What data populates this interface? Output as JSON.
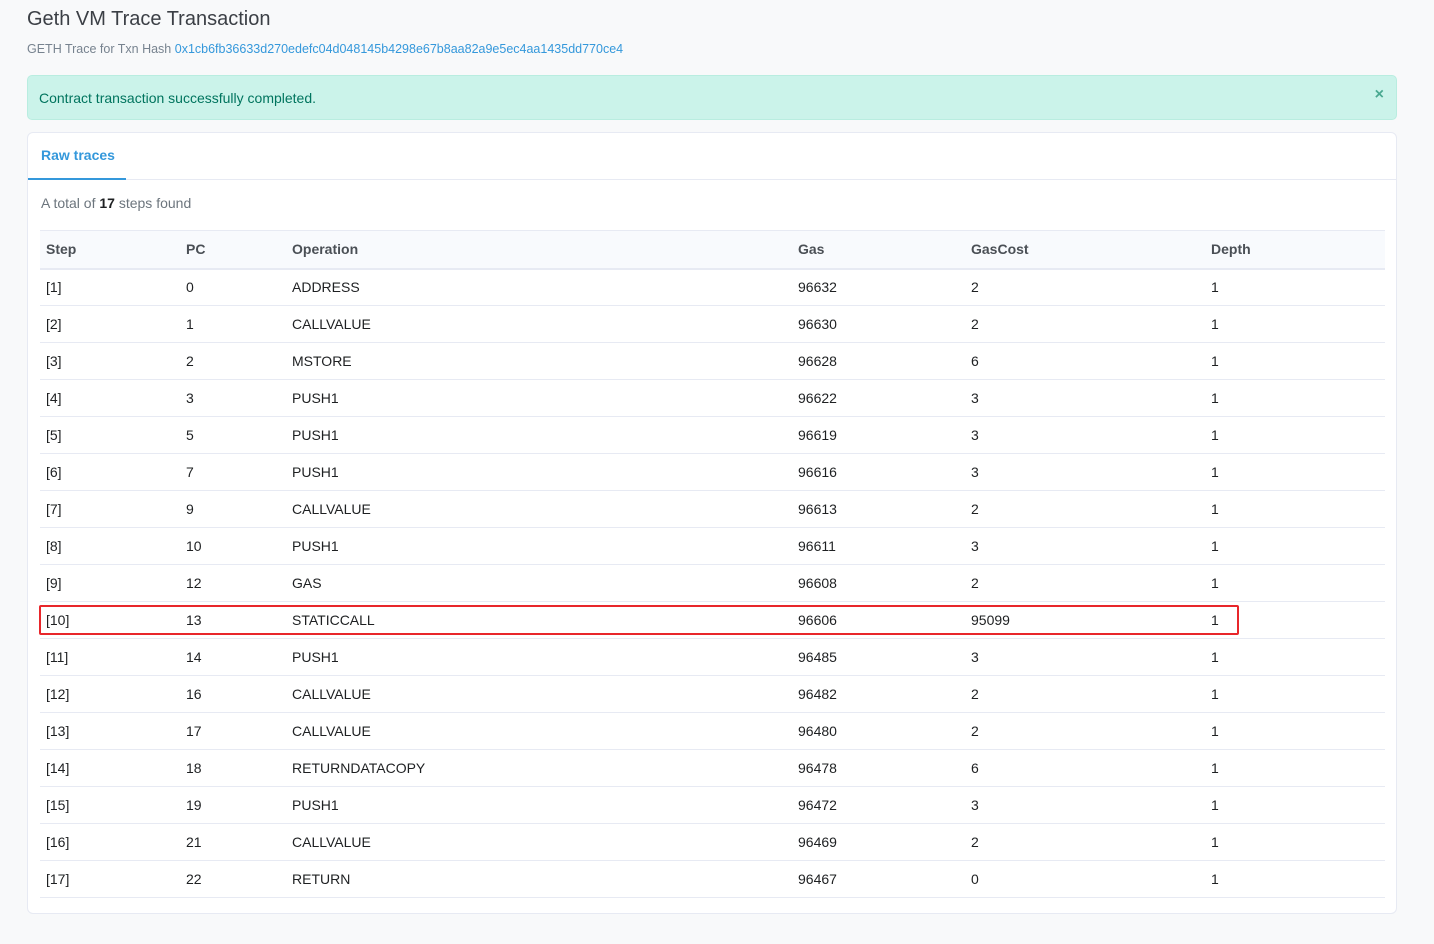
{
  "header": {
    "title": "Geth VM Trace Transaction",
    "subtitle_prefix": "GETH Trace for Txn Hash",
    "txn_hash": "0x1cb6fb36633d270edefc04d048145b4298e67b8aa82a9e5ec4aa1435dd770ce4"
  },
  "alert": {
    "message": "Contract transaction successfully completed.",
    "close_symbol": "×"
  },
  "tabs": [
    {
      "label": "Raw traces"
    }
  ],
  "summary": {
    "prefix": "A total of",
    "count": "17",
    "suffix": "steps found"
  },
  "table": {
    "columns": [
      "Step",
      "PC",
      "Operation",
      "Gas",
      "GasCost",
      "Depth"
    ],
    "rows": [
      [
        "[1]",
        "0",
        "ADDRESS",
        "96632",
        "2",
        "1"
      ],
      [
        "[2]",
        "1",
        "CALLVALUE",
        "96630",
        "2",
        "1"
      ],
      [
        "[3]",
        "2",
        "MSTORE",
        "96628",
        "6",
        "1"
      ],
      [
        "[4]",
        "3",
        "PUSH1",
        "96622",
        "3",
        "1"
      ],
      [
        "[5]",
        "5",
        "PUSH1",
        "96619",
        "3",
        "1"
      ],
      [
        "[6]",
        "7",
        "PUSH1",
        "96616",
        "3",
        "1"
      ],
      [
        "[7]",
        "9",
        "CALLVALUE",
        "96613",
        "2",
        "1"
      ],
      [
        "[8]",
        "10",
        "PUSH1",
        "96611",
        "3",
        "1"
      ],
      [
        "[9]",
        "12",
        "GAS",
        "96608",
        "2",
        "1"
      ],
      [
        "[10]",
        "13",
        "STATICCALL",
        "96606",
        "95099",
        "1"
      ],
      [
        "[11]",
        "14",
        "PUSH1",
        "96485",
        "3",
        "1"
      ],
      [
        "[12]",
        "16",
        "CALLVALUE",
        "96482",
        "2",
        "1"
      ],
      [
        "[13]",
        "17",
        "CALLVALUE",
        "96480",
        "2",
        "1"
      ],
      [
        "[14]",
        "18",
        "RETURNDATACOPY",
        "96478",
        "6",
        "1"
      ],
      [
        "[15]",
        "19",
        "PUSH1",
        "96472",
        "3",
        "1"
      ],
      [
        "[16]",
        "21",
        "CALLVALUE",
        "96469",
        "2",
        "1"
      ],
      [
        "[17]",
        "22",
        "RETURN",
        "96467",
        "0",
        "1"
      ]
    ]
  },
  "colors": {
    "accent": "#3498db",
    "alert_bg": "#cbf3ea",
    "highlight": "#e8262b"
  }
}
